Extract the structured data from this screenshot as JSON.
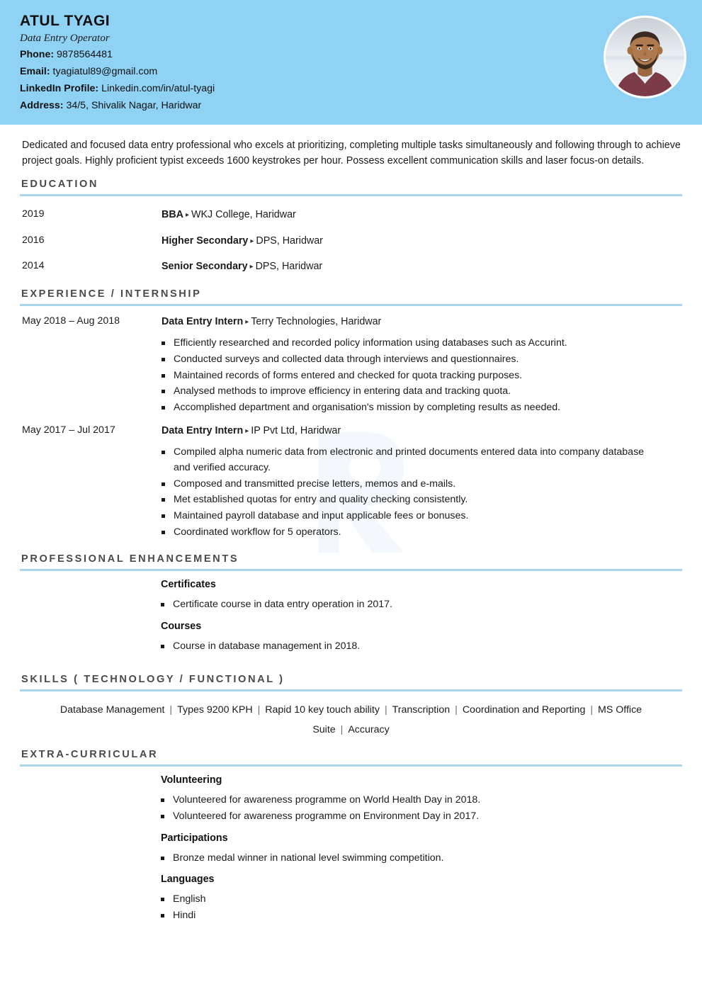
{
  "header": {
    "name": "ATUL TYAGI",
    "role": "Data Entry Operator",
    "contacts": [
      {
        "label": "Phone:",
        "value": "9878564481"
      },
      {
        "label": "Email:",
        "value": "tyagiatul89@gmail.com"
      },
      {
        "label": "LinkedIn Profile:",
        "value": "Linkedin.com/in/atul-tyagi"
      },
      {
        "label": "Address:",
        "value": "34/5, Shivalik Nagar, Haridwar"
      }
    ],
    "photo_alt": "profile-photo",
    "background_color": "#8fd2f4"
  },
  "summary": "Dedicated and focused data entry professional who excels at prioritizing, completing multiple tasks simultaneously and following through to achieve project goals. Highly proficient typist exceeds 1600 keystrokes per hour. Possess excellent communication skills and laser focus-on details.",
  "sections": {
    "education": {
      "title": "EDUCATION",
      "items": [
        {
          "date": "2019",
          "degree": "BBA",
          "sep": "▸",
          "institute": "WKJ College, Haridwar"
        },
        {
          "date": "2016",
          "degree": "Higher Secondary",
          "sep": "▸",
          "institute": "DPS, Haridwar"
        },
        {
          "date": "2014",
          "degree": "Senior Secondary",
          "sep": "▸",
          "institute": "DPS, Haridwar"
        }
      ]
    },
    "experience": {
      "title": "EXPERIENCE / INTERNSHIP",
      "items": [
        {
          "date": "May 2018 – Aug 2018",
          "role": "Data Entry Intern",
          "sep": "▸",
          "company": "Terry Technologies, Haridwar",
          "bullets": [
            "Efficiently researched and recorded policy information using databases such as Accurint.",
            "Conducted surveys and collected data through interviews and questionnaires.",
            "Maintained records of forms entered and checked for quota tracking purposes.",
            "Analysed methods to improve efficiency in entering data and tracking quota.",
            "Accomplished department and organisation's mission by completing results as needed."
          ]
        },
        {
          "date": "May 2017 – Jul 2017",
          "role": "Data Entry Intern",
          "sep": "▸",
          "company": "IP Pvt Ltd, Haridwar",
          "bullets": [
            "Compiled alpha numeric data from electronic and printed documents entered data into company database and verified accuracy.",
            "Composed and transmitted precise letters, memos and e-mails.",
            "Met established quotas for entry and quality checking consistently.",
            "Maintained payroll database and input applicable fees or bonuses.",
            "Coordinated workflow for 5 operators."
          ]
        }
      ]
    },
    "professional_enhancements": {
      "title": "PROFESSIONAL ENHANCEMENTS",
      "groups": [
        {
          "heading": "Certificates",
          "bullets": [
            "Certificate course in data entry operation in 2017."
          ]
        },
        {
          "heading": "Courses",
          "bullets": [
            "Course in database management in 2018."
          ]
        }
      ]
    },
    "skills": {
      "title": "SKILLS ( TECHNOLOGY / FUNCTIONAL )",
      "items": [
        "Database Management",
        "Types 9200 KPH",
        "Rapid 10 key touch ability",
        "Transcription",
        "Coordination and Reporting",
        "MS Office Suite",
        "Accuracy"
      ],
      "separator": "|"
    },
    "extra_curricular": {
      "title": "EXTRA-CURRICULAR",
      "groups": [
        {
          "heading": "Volunteering",
          "bullets": [
            "Volunteered for awareness programme on World Health Day in 2018.",
            "Volunteered for awareness programme on Environment Day in 2017."
          ]
        },
        {
          "heading": "Participations",
          "bullets": [
            "Bronze medal winner in national level swimming competition."
          ]
        },
        {
          "heading": "Languages",
          "bullets": [
            "English",
            "Hindi"
          ]
        }
      ]
    }
  },
  "theme": {
    "header_blue": "#8fd2f4",
    "rule_blue": "#aad6ea",
    "heading_gray": "#4a4a4a",
    "text_black": "#1b1b1b"
  }
}
